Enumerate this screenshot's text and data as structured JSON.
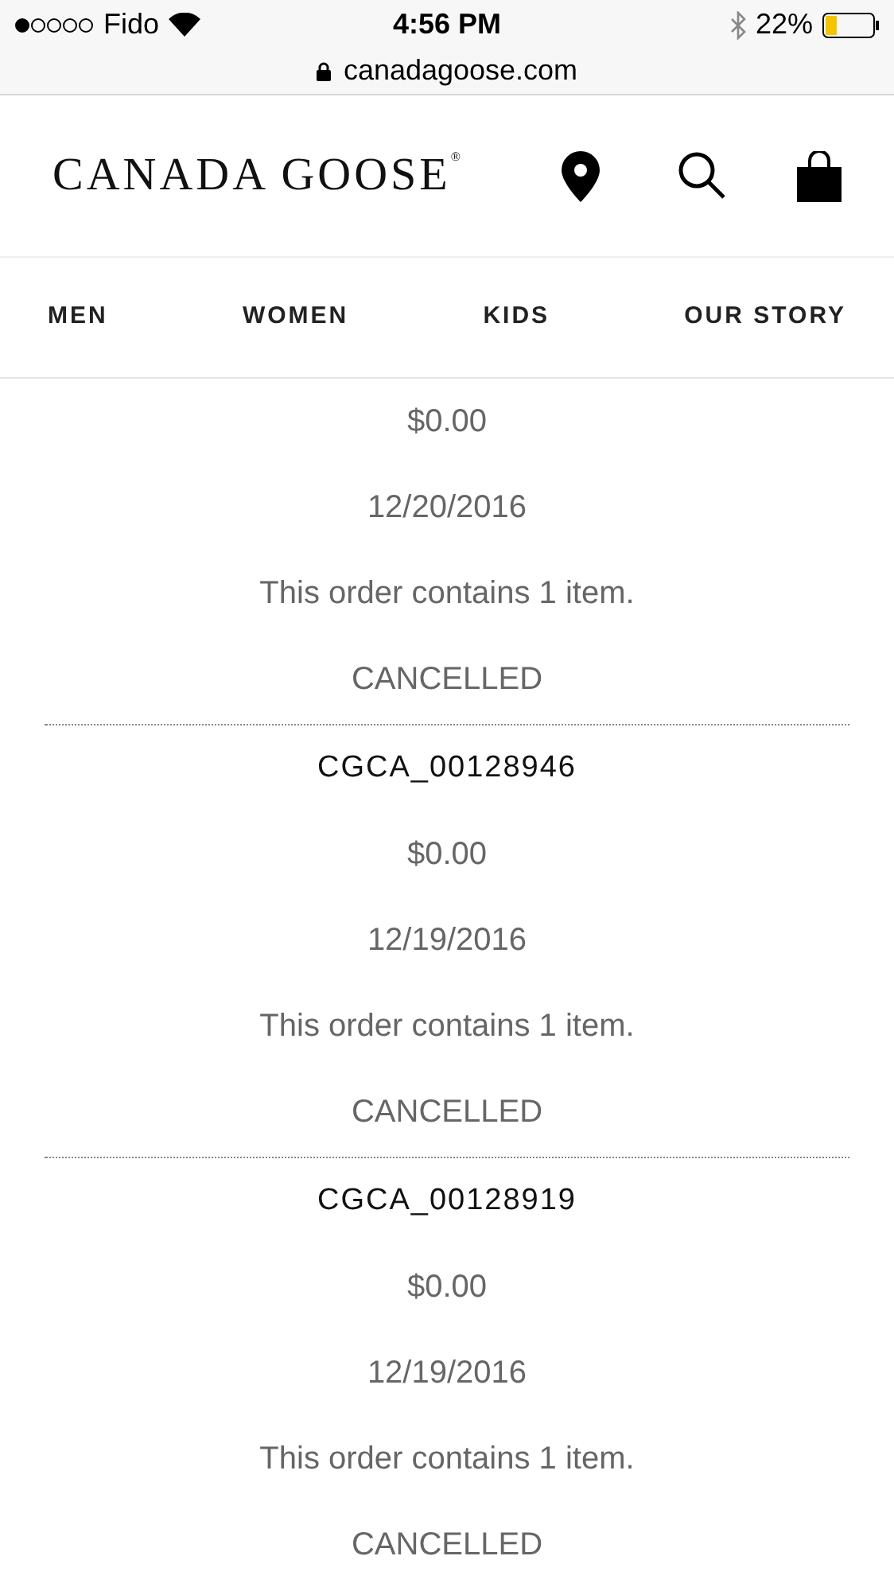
{
  "status_bar": {
    "carrier": "Fido",
    "time": "4:56 PM",
    "battery": "22%"
  },
  "address_bar": {
    "url": "canadagoose.com"
  },
  "header": {
    "logo": "CANADA GOOSE",
    "logo_mark": "®"
  },
  "nav": {
    "items": [
      {
        "label": "MEN"
      },
      {
        "label": "WOMEN"
      },
      {
        "label": "KIDS"
      },
      {
        "label": "OUR STORY"
      }
    ]
  },
  "orders": [
    {
      "total": "$0.00",
      "date": "12/20/2016",
      "summary": "This order contains 1 item.",
      "status": "CANCELLED"
    },
    {
      "number": "CGCA_00128946",
      "total": "$0.00",
      "date": "12/19/2016",
      "summary": "This order contains 1 item.",
      "status": "CANCELLED"
    },
    {
      "number": "CGCA_00128919",
      "total": "$0.00",
      "date": "12/19/2016",
      "summary": "This order contains 1 item.",
      "status": "CANCELLED"
    }
  ]
}
